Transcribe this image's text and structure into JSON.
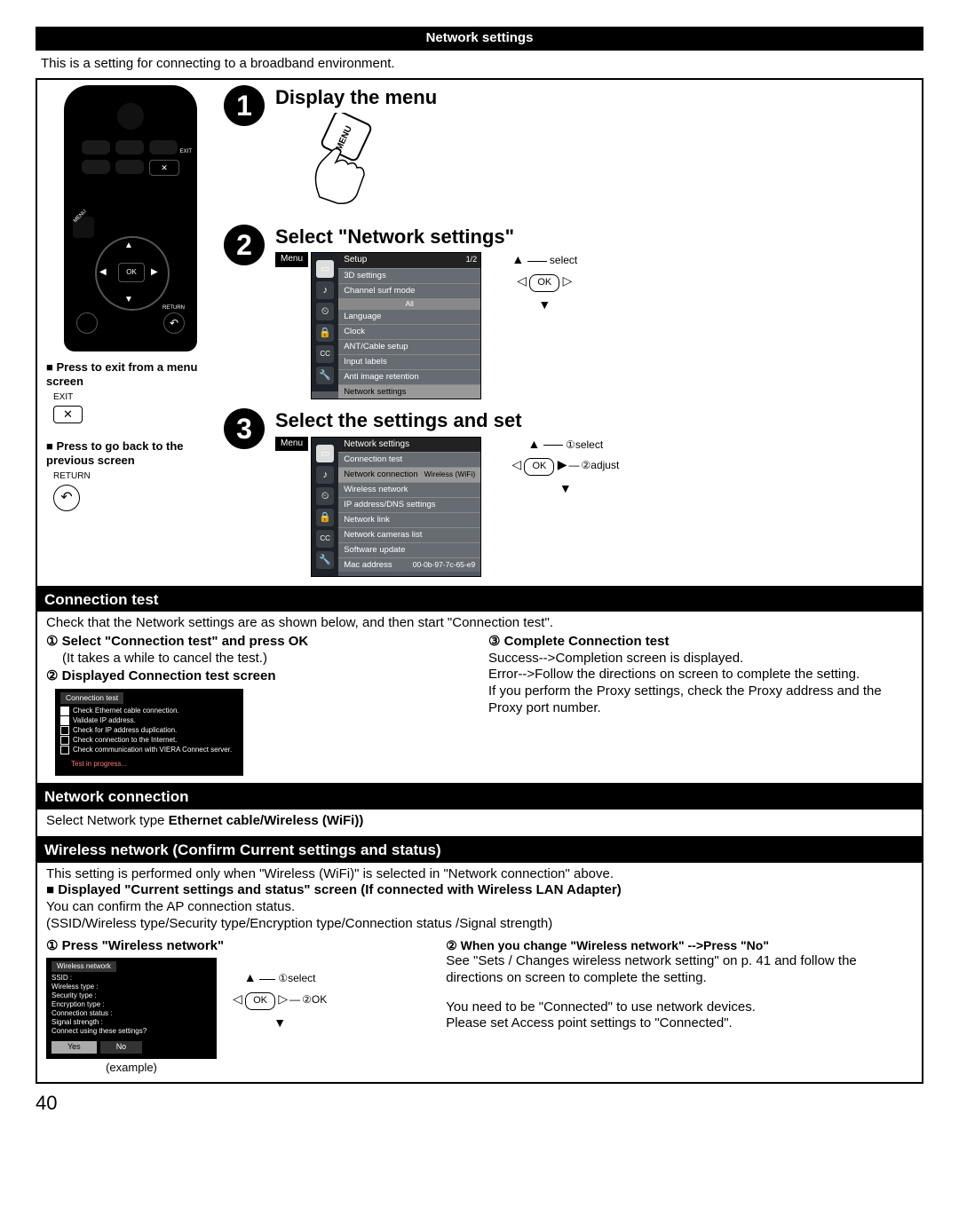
{
  "header": {
    "title": "Network settings"
  },
  "intro": "This is a setting for connecting to a broadband environment.",
  "page_number": "40",
  "steps": {
    "s1": {
      "num": "1",
      "title": "Display the menu",
      "btn_label": "MENU"
    },
    "s2": {
      "num": "2",
      "title": "Select \"Network settings\"",
      "menu_title": "Menu",
      "setup": "Setup",
      "page": "1/2",
      "items": [
        "3D settings",
        "Channel surf mode",
        "Language",
        "Clock",
        "ANT/Cable setup",
        "Input labels",
        "Anti image retention",
        "Network settings"
      ],
      "all": "All",
      "nav_select": "select",
      "nav_ok": "OK"
    },
    "s3": {
      "num": "3",
      "title": "Select the settings and set",
      "menu_title": "Menu",
      "setup": "Network settings",
      "items": [
        "Connection test",
        "Network connection",
        "Wireless network",
        "IP address/DNS settings",
        "Network link",
        "Network cameras list",
        "Software update",
        "Mac address"
      ],
      "conn_val": "Wireless (WiFi)",
      "mac_val": "00-0b-97-7c-65-e9",
      "nav1": "select",
      "nav2": "adjust",
      "nav_ok": "OK",
      "c1": "①",
      "c2": "②"
    }
  },
  "remote_notes": {
    "exit_title": "Press to exit from a menu screen",
    "exit_label": "EXIT",
    "exit_x": "✕",
    "return_title": "Press to go back to the previous screen",
    "return_label": "RETURN"
  },
  "conn_test": {
    "heading": "Connection test",
    "lead": "Check that the Network settings are as shown below, and then start \"Connection test\".",
    "l1": "① Select \"Connection test\" and press OK",
    "l1b": "(It takes a while to cancel the test.)",
    "l2": "② Displayed Connection test screen",
    "panel_title": "Connection test",
    "panel_lines": [
      "Check Ethernet cable connection.",
      "Validate IP address.",
      "Check for IP address duplication.",
      "Check connection to the Internet.",
      "Check communication with VIERA Connect server."
    ],
    "panel_status": "Test in progress...",
    "r1": "③ Complete Connection test",
    "r1a": "Success-->Completion screen is displayed.",
    "r1b": "Error-->Follow the directions on screen to complete the setting.",
    "r1c": "If you perform the Proxy settings, check the Proxy address and the Proxy port number."
  },
  "net_conn": {
    "heading": "Network connection",
    "line_a": "Select Network type ",
    "line_b": "Ethernet cable/Wireless (WiFi))"
  },
  "wireless": {
    "heading": "Wireless network (Confirm Current settings and status)",
    "p1": "This setting is performed only when \"Wireless (WiFi)\" is selected in \"Network connection\" above.",
    "p2": "Displayed \"Current settings and status\" screen (If connected with Wireless LAN Adapter)",
    "p3": "You can confirm the AP connection status.",
    "p4": "(SSID/Wireless type/Security type/Encryption type/Connection status /Signal strength)",
    "l1": "① Press \"Wireless network\"",
    "panel_title": "Wireless network",
    "panel_fields": [
      "SSID :",
      "Wireless type :",
      "Security type :",
      "Encryption type :",
      "Connection status :",
      "Signal strength :",
      "Connect using these settings?"
    ],
    "yes": "Yes",
    "no": "No",
    "example": "(example)",
    "nav1": "select",
    "nav2": "OK",
    "c1": "①",
    "c2": "②",
    "nav_ok": "OK",
    "r_head": "② When you change \"Wireless network\" -->Press \"No\"",
    "r1": "See \"Sets / Changes wireless network setting\" on p. 41 and follow the directions on screen to complete the setting.",
    "r2": "You need to be \"Connected\" to use network devices.",
    "r3": "Please set Access point settings to \"Connected\"."
  }
}
